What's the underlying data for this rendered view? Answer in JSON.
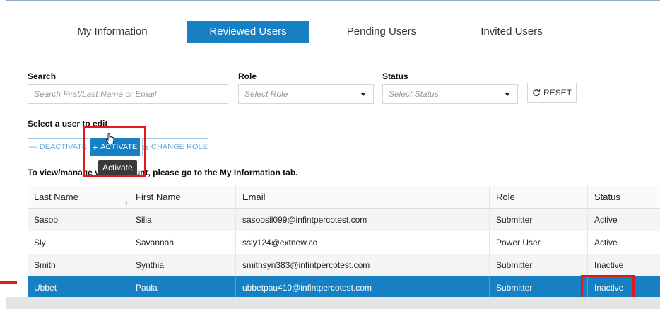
{
  "tabs": [
    {
      "label": "My Information",
      "active": false
    },
    {
      "label": "Reviewed Users",
      "active": true
    },
    {
      "label": "Pending Users",
      "active": false
    },
    {
      "label": "Invited Users",
      "active": false
    }
  ],
  "filters": {
    "search_label": "Search",
    "search_placeholder": "Search First/Last Name or Email",
    "role_label": "Role",
    "role_placeholder": "Select Role",
    "status_label": "Status",
    "status_placeholder": "Select Status",
    "reset_label": "RESET"
  },
  "select_user_text": "Select a user to edit",
  "actions": {
    "deactivate_label": "DEACTIVATE",
    "activate_label": "ACTIVATE",
    "change_role_label": "CHANGE ROLE",
    "tooltip": "Activate"
  },
  "info_text": "To view/manage your account, please go to the My Information tab.",
  "table": {
    "headers": [
      "Last Name",
      "First Name",
      "Email",
      "Role",
      "Status"
    ],
    "rows": [
      [
        "Sasoo",
        "Silia",
        "sasoosil099@infintpercotest.com",
        "Submitter",
        "Active"
      ],
      [
        "Sly",
        "Savannah",
        "ssly124@extnew.co",
        "Power User",
        "Active"
      ],
      [
        "Smith",
        "Synthia",
        "smithsyn383@infintpercotest.com",
        "Submitter",
        "Inactive"
      ],
      [
        "Ubbet",
        "Paula",
        "ubbetpau410@infintpercotest.com",
        "Submitter",
        "Inactive"
      ]
    ]
  },
  "colors": {
    "accent": "#1780c2",
    "highlight": "#e0191f"
  }
}
